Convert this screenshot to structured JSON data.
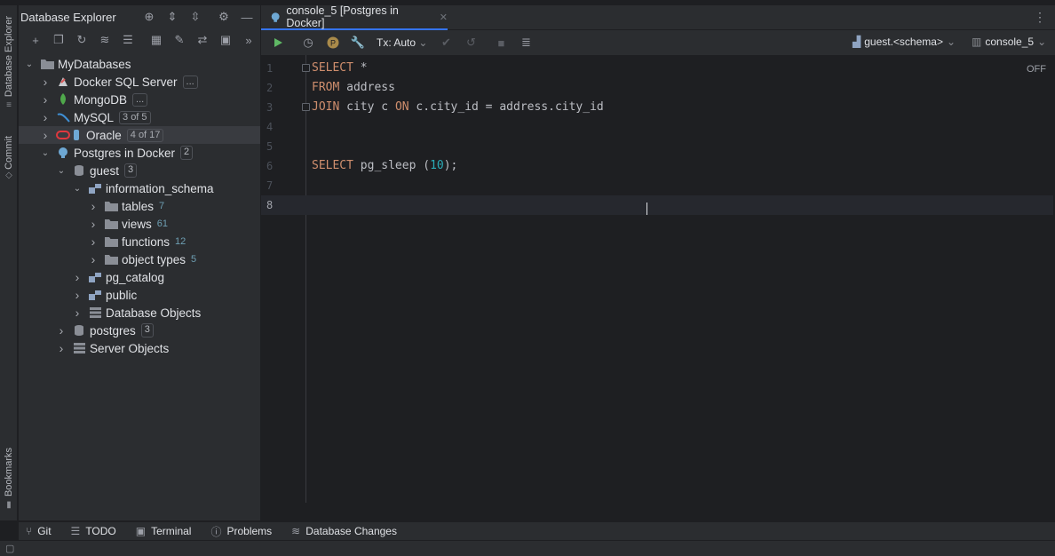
{
  "left_strip": {
    "tabs": [
      "Database Explorer",
      "Commit",
      "Bookmarks"
    ]
  },
  "explorer": {
    "title": "Database Explorer",
    "tree": [
      {
        "label": "MyDatabases",
        "depth": 0,
        "expanded": true
      },
      {
        "label": "Docker SQL Server",
        "depth": 1,
        "badge": "..."
      },
      {
        "label": "MongoDB",
        "depth": 1,
        "badge": "..."
      },
      {
        "label": "MySQL",
        "depth": 1,
        "badge": "3 of 5"
      },
      {
        "label": "Oracle",
        "depth": 1,
        "badge": "4 of 17",
        "selected": true
      },
      {
        "label": "Postgres in Docker",
        "depth": 1,
        "pill": "2",
        "expanded": true
      },
      {
        "label": "guest",
        "depth": 2,
        "pill": "3",
        "expanded": true
      },
      {
        "label": "information_schema",
        "depth": 3,
        "expanded": true
      },
      {
        "label": "tables",
        "depth": 4,
        "count": "7"
      },
      {
        "label": "views",
        "depth": 4,
        "count": "61"
      },
      {
        "label": "functions",
        "depth": 4,
        "count": "12"
      },
      {
        "label": "object types",
        "depth": 4,
        "count": "5"
      },
      {
        "label": "pg_catalog",
        "depth": 3
      },
      {
        "label": "public",
        "depth": 3
      },
      {
        "label": "Database Objects",
        "depth": 3
      },
      {
        "label": "postgres",
        "depth": 2,
        "pill": "3"
      },
      {
        "label": "Server Objects",
        "depth": 2
      }
    ]
  },
  "editor": {
    "tab_label": "console_5 [Postgres in Docker]",
    "tx_mode": "Tx: Auto",
    "schema_selector": "guest.<schema>",
    "session_selector": "console_5",
    "inlay_status": "OFF",
    "lines": [
      {
        "num": "1",
        "parts": [
          [
            "kw",
            "SELECT"
          ],
          [
            "t",
            " *"
          ]
        ]
      },
      {
        "num": "2",
        "parts": [
          [
            "kw",
            "FROM"
          ],
          [
            "t",
            " address"
          ]
        ]
      },
      {
        "num": "3",
        "parts": [
          [
            "kw",
            "JOIN"
          ],
          [
            "t",
            " city c "
          ],
          [
            "kw",
            "ON"
          ],
          [
            "t",
            " c.city_id = address.city_id"
          ]
        ]
      },
      {
        "num": "4",
        "parts": []
      },
      {
        "num": "5",
        "parts": []
      },
      {
        "num": "6",
        "parts": [
          [
            "kw",
            "SELECT"
          ],
          [
            "t",
            " pg_sleep ("
          ],
          [
            "num",
            "10"
          ],
          [
            "t",
            ");"
          ]
        ]
      },
      {
        "num": "7",
        "parts": []
      },
      {
        "num": "8",
        "parts": [],
        "current": true
      }
    ]
  },
  "bottom_tools": [
    "Git",
    "TODO",
    "Terminal",
    "Problems",
    "Database Changes"
  ],
  "colors": {
    "accent": "#3574f0",
    "keyword": "#cf8e6d",
    "number": "#2aacb8",
    "oracle": "#e0383e",
    "mongodb": "#4fa84b",
    "mysql": "#3f8fd4",
    "postgres": "#6ea8d4",
    "run": "#5fb865"
  }
}
